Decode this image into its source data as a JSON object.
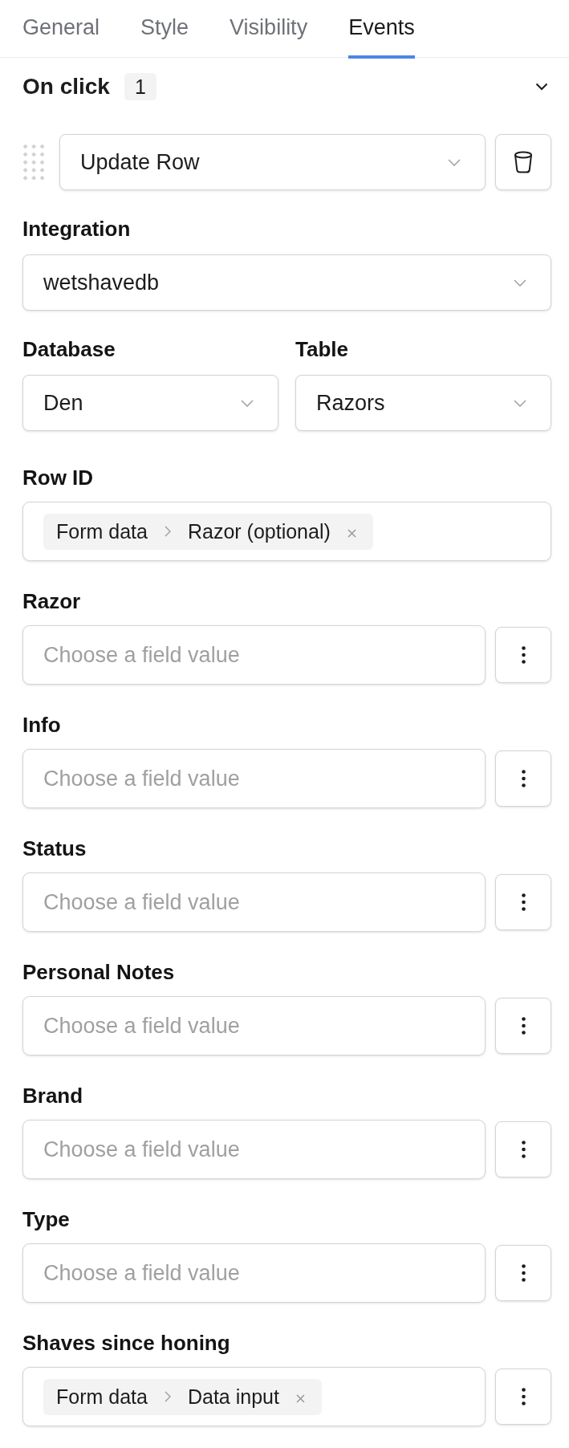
{
  "tabs": [
    {
      "label": "General",
      "selected": false
    },
    {
      "label": "Style",
      "selected": false
    },
    {
      "label": "Visibility",
      "selected": false
    },
    {
      "label": "Events",
      "selected": true
    }
  ],
  "event": {
    "title": "On click",
    "count": "1"
  },
  "action": {
    "value": "Update Row"
  },
  "integration": {
    "label": "Integration",
    "value": "wetshavedb"
  },
  "location": [
    {
      "label": "Database",
      "value": "Den"
    },
    {
      "label": "Table",
      "value": "Razors"
    }
  ],
  "row_id": {
    "label": "Row ID",
    "chip": [
      "Form data",
      "Razor (optional)"
    ]
  },
  "columns": [
    {
      "label": "Razor",
      "kind": "empty",
      "placeholder": "Choose a field value"
    },
    {
      "label": "Info",
      "kind": "empty",
      "placeholder": "Choose a field value"
    },
    {
      "label": "Status",
      "kind": "empty",
      "placeholder": "Choose a field value"
    },
    {
      "label": "Personal Notes",
      "kind": "empty",
      "placeholder": "Choose a field value"
    },
    {
      "label": "Brand",
      "kind": "empty",
      "placeholder": "Choose a field value"
    },
    {
      "label": "Type",
      "kind": "empty",
      "placeholder": "Choose a field value"
    },
    {
      "label": "Shaves since honing",
      "kind": "bound",
      "chip": [
        "Form data",
        "Data input"
      ]
    }
  ]
}
